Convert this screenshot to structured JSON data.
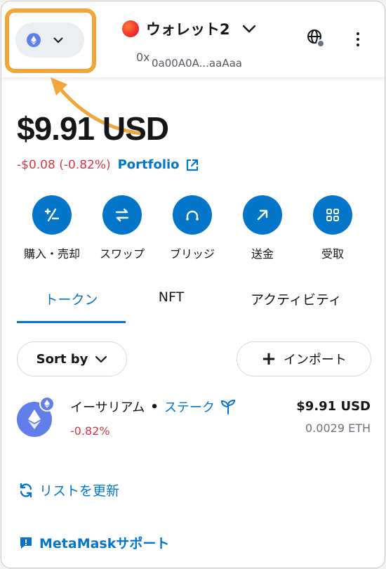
{
  "header": {
    "network": {
      "icon": "ethereum-icon",
      "chevron": "chevron-down-icon"
    },
    "account": {
      "name": "ウォレット2",
      "address": "0x…",
      "address_display": "0a00A0A...aaAaa"
    },
    "globe_icon": "globe-icon",
    "menu_icon": "kebab-menu-icon"
  },
  "balance": {
    "amount": "$9.91 USD",
    "change": "-$0.08 (-0.82%)",
    "portfolio_label": "Portfolio"
  },
  "actions": [
    {
      "label": "購入・売却",
      "icon": "buy-sell-icon"
    },
    {
      "label": "スワップ",
      "icon": "swap-icon"
    },
    {
      "label": "ブリッジ",
      "icon": "bridge-icon"
    },
    {
      "label": "送金",
      "icon": "send-icon"
    },
    {
      "label": "受取",
      "icon": "receive-icon"
    }
  ],
  "tabs": [
    {
      "label": "トークン",
      "active": true
    },
    {
      "label": "NFT",
      "active": false
    },
    {
      "label": "アクティビティ",
      "active": false
    }
  ],
  "toolbar": {
    "sort_label": "Sort by",
    "import_label": "インポート"
  },
  "tokens": [
    {
      "name": "イーサリアム",
      "separator": "•",
      "stake_label": "ステーク",
      "change": "-0.82%",
      "fiat": "$9.91 USD",
      "amount": "0.0029 ETH"
    }
  ],
  "links": {
    "refresh": "リストを更新",
    "support": "MetaMaskサポート"
  },
  "colors": {
    "accent": "#0376c9",
    "negative": "#d73847",
    "highlight": "#f1a63c",
    "eth": "#627eea"
  }
}
